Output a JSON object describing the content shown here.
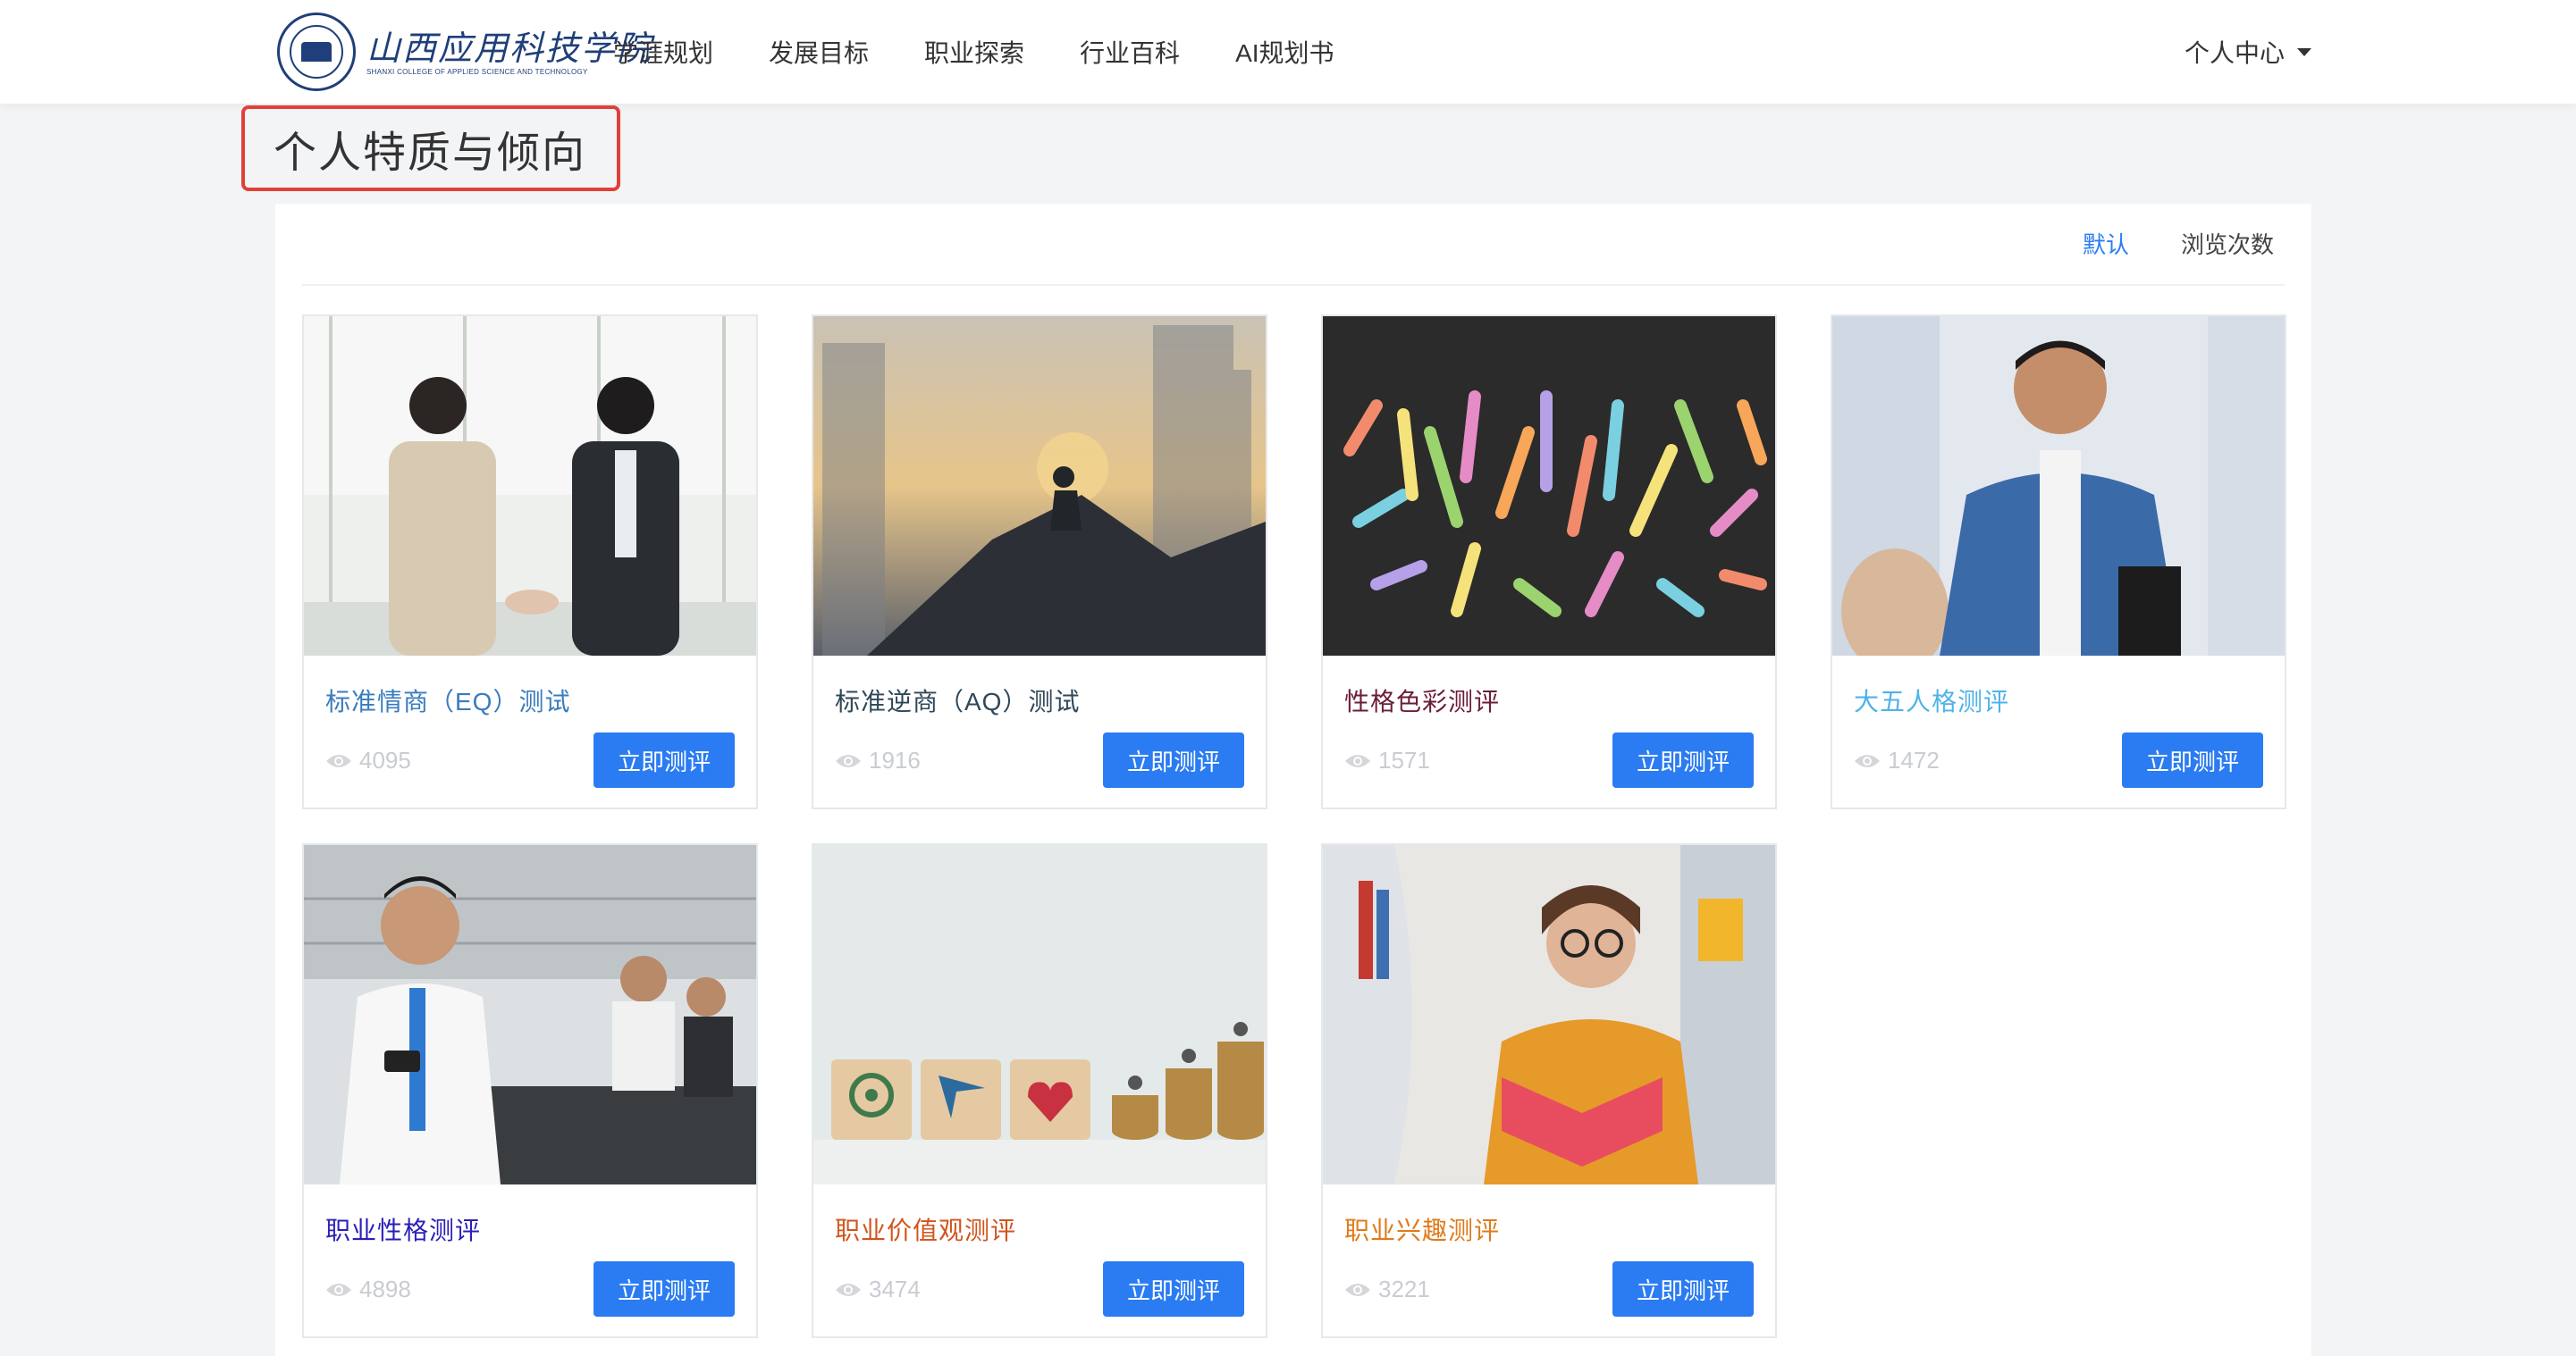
{
  "brand": {
    "name_cn": "山西应用科技学院",
    "name_en": "SHANXI COLLEGE OF APPLIED SCIENCE AND TECHNOLOGY"
  },
  "nav": {
    "items": [
      "学涯规划",
      "发展目标",
      "职业探索",
      "行业百科",
      "AI规划书"
    ],
    "user_menu": "个人中心"
  },
  "page": {
    "title": "个人特质与倾向"
  },
  "sort": {
    "default_label": "默认",
    "views_label": "浏览次数"
  },
  "colors": {
    "accent": "#2b7cf2",
    "highlight_border": "#e0403a"
  },
  "cards": [
    {
      "title": "标准情商（EQ）测试",
      "views": "4095",
      "button": "立即测评",
      "title_color": "#3a7bbf"
    },
    {
      "title": "标准逆商（AQ）测试",
      "views": "1916",
      "button": "立即测评",
      "title_color": "#2f4858"
    },
    {
      "title": "性格色彩测评",
      "views": "1571",
      "button": "立即测评",
      "title_color": "#6b1d3a"
    },
    {
      "title": "大五人格测评",
      "views": "1472",
      "button": "立即测评",
      "title_color": "#4fb3e8"
    },
    {
      "title": "职业性格测评",
      "views": "4898",
      "button": "立即测评",
      "title_color": "#2a1fb8"
    },
    {
      "title": "职业价值观测评",
      "views": "3474",
      "button": "立即测评",
      "title_color": "#d2541c"
    },
    {
      "title": "职业兴趣测评",
      "views": "3221",
      "button": "立即测评",
      "title_color": "#e07a1a"
    }
  ]
}
